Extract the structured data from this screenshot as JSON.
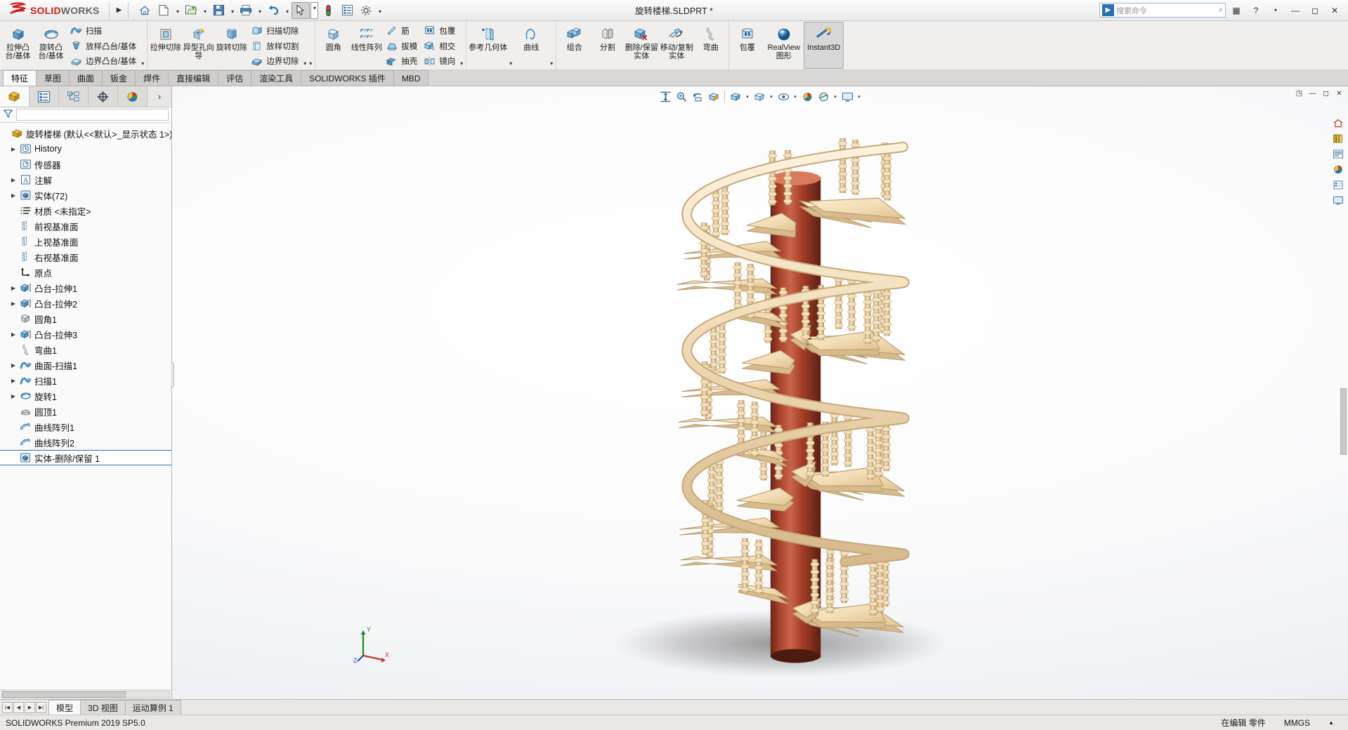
{
  "app": {
    "brand_ds": "2S",
    "brand_bold": "SOLID",
    "brand_light": "WORKS",
    "document_title": "旋转楼梯.SLDPRT *",
    "status_left": "SOLIDWORKS Premium 2019 SP5.0",
    "status_editing": "在编辑 零件",
    "status_units": "MMGS",
    "status_caret": "▲"
  },
  "titlebar": {
    "expand_icon": "▶",
    "buttons": [
      {
        "name": "home-icon",
        "glyph": "home",
        "caret": false,
        "selected": false
      },
      {
        "name": "new-document-icon",
        "glyph": "newdoc",
        "caret": true,
        "selected": false
      },
      {
        "name": "open-document-icon",
        "glyph": "open",
        "caret": true,
        "selected": false
      },
      {
        "name": "save-icon",
        "glyph": "save",
        "caret": true,
        "selected": false
      },
      {
        "name": "print-icon",
        "glyph": "print",
        "caret": true,
        "selected": false
      },
      {
        "name": "undo-icon",
        "glyph": "undo",
        "caret": true,
        "selected": false
      },
      {
        "name": "select-cursor-icon",
        "glyph": "cursor",
        "caret": true,
        "selected": true
      },
      {
        "name": "rebuild-icon",
        "glyph": "traffic",
        "caret": false,
        "selected": false
      },
      {
        "name": "options-list-icon",
        "glyph": "list",
        "caret": false,
        "selected": false
      },
      {
        "name": "settings-gear-icon",
        "glyph": "gear",
        "caret": true,
        "selected": false
      }
    ],
    "search_placeholder": "搜索命令",
    "window_buttons": [
      "▦",
      "?",
      "▾",
      "—",
      "◻",
      "✕"
    ]
  },
  "ribbon": {
    "groups": [
      {
        "name": "features-boss",
        "big": [
          {
            "label": "拉伸凸台/基体",
            "icon": "extrude-boss",
            "caret": false
          },
          {
            "label": "旋转凸台/基体",
            "icon": "revolve-boss",
            "caret": false
          }
        ],
        "small": [
          {
            "label": "扫描",
            "icon": "sweep"
          },
          {
            "label": "放样凸台/基体",
            "icon": "loft"
          },
          {
            "label": "边界凸台/基体",
            "icon": "boundary"
          }
        ],
        "small_caret": true
      },
      {
        "name": "features-cut",
        "big": [
          {
            "label": "拉伸切除",
            "icon": "extrude-cut",
            "caret": false
          },
          {
            "label": "异型孔向导",
            "icon": "hole-wizard",
            "caret": false
          },
          {
            "label": "旋转切除",
            "icon": "revolve-cut",
            "caret": false
          }
        ],
        "small": [
          {
            "label": "扫描切除",
            "icon": "sweep-cut"
          },
          {
            "label": "放样切割",
            "icon": "loft-cut"
          },
          {
            "label": "边界切除",
            "icon": "boundary-cut"
          }
        ],
        "small_caret": true
      },
      {
        "name": "features-modify",
        "big": [
          {
            "label": "圆角",
            "icon": "fillet",
            "caret": false
          },
          {
            "label": "线性阵列",
            "icon": "linear-pattern",
            "caret": false
          }
        ],
        "small": [
          {
            "label": "筋",
            "icon": "rib"
          },
          {
            "label": "拔模",
            "icon": "draft"
          },
          {
            "label": "抽壳",
            "icon": "shell"
          }
        ],
        "small2": [
          {
            "label": "包覆",
            "icon": "wrap"
          },
          {
            "label": "相交",
            "icon": "intersect"
          },
          {
            "label": "镜向",
            "icon": "mirror"
          }
        ]
      },
      {
        "name": "reference-geometry",
        "big": [
          {
            "label": "参考几何体",
            "icon": "reference-plane",
            "caret": true
          },
          {
            "label": "曲线",
            "icon": "curve",
            "caret": true
          }
        ],
        "small": []
      },
      {
        "name": "bodies",
        "big": [
          {
            "label": "组合",
            "icon": "combine",
            "caret": false
          },
          {
            "label": "分割",
            "icon": "split",
            "caret": false
          },
          {
            "label": "删除/保留实体",
            "icon": "delete-keep-body",
            "caret": false
          },
          {
            "label": "移动/复制实体",
            "icon": "move-copy-body",
            "caret": false
          },
          {
            "label": "弯曲",
            "icon": "flex",
            "caret": false
          }
        ],
        "small": []
      },
      {
        "name": "display",
        "big": [
          {
            "label": "包覆",
            "icon": "wrap2",
            "caret": false
          },
          {
            "label": "RealView 图形",
            "icon": "realview",
            "caret": false
          },
          {
            "label": "Instant3D",
            "icon": "instant3d",
            "caret": false,
            "active": true
          }
        ],
        "small": []
      }
    ]
  },
  "tabs": {
    "items": [
      {
        "label": "特征",
        "active": true
      },
      {
        "label": "草图",
        "active": false
      },
      {
        "label": "曲面",
        "active": false
      },
      {
        "label": "钣金",
        "active": false
      },
      {
        "label": "焊件",
        "active": false
      },
      {
        "label": "直接编辑",
        "active": false
      },
      {
        "label": "评估",
        "active": false
      },
      {
        "label": "渲染工具",
        "active": false
      },
      {
        "label": "SOLIDWORKS 插件",
        "active": false
      },
      {
        "label": "MBD",
        "active": false
      }
    ]
  },
  "tree_panel": {
    "tabs": [
      {
        "name": "feature-manager-tab",
        "icon": "feature-tree",
        "active": true
      },
      {
        "name": "property-manager-tab",
        "icon": "property-list",
        "active": false
      },
      {
        "name": "configuration-manager-tab",
        "icon": "configuration",
        "active": false
      },
      {
        "name": "dimxpert-manager-tab",
        "icon": "dimxpert",
        "active": false
      },
      {
        "name": "display-manager-tab",
        "icon": "appearance-sphere",
        "active": false
      }
    ],
    "more_icon": "›",
    "filter_placeholder": "",
    "root": {
      "label": "旋转楼梯  (默认<<默认>_显示状态 1>)",
      "icon": "part-root"
    },
    "items": [
      {
        "label": "History",
        "icon": "history",
        "expand": true,
        "indent": 1
      },
      {
        "label": "传感器",
        "icon": "sensor",
        "expand": false,
        "indent": 1
      },
      {
        "label": "注解",
        "icon": "annotations",
        "expand": true,
        "indent": 1
      },
      {
        "label": "实体(72)",
        "icon": "solid-bodies",
        "expand": true,
        "indent": 1
      },
      {
        "label": "材质 <未指定>",
        "icon": "material",
        "expand": false,
        "indent": 1
      },
      {
        "label": "前视基准面",
        "icon": "plane",
        "expand": false,
        "indent": 1
      },
      {
        "label": "上视基准面",
        "icon": "plane",
        "expand": false,
        "indent": 1
      },
      {
        "label": "右视基准面",
        "icon": "plane",
        "expand": false,
        "indent": 1
      },
      {
        "label": "原点",
        "icon": "origin",
        "expand": false,
        "indent": 1
      },
      {
        "label": "凸台-拉伸1",
        "icon": "extrude-feature",
        "expand": true,
        "indent": 1
      },
      {
        "label": "凸台-拉伸2",
        "icon": "extrude-feature",
        "expand": true,
        "indent": 1
      },
      {
        "label": "圆角1",
        "icon": "fillet-feature",
        "expand": false,
        "indent": 1
      },
      {
        "label": "凸台-拉伸3",
        "icon": "extrude-feature",
        "expand": true,
        "indent": 1
      },
      {
        "label": "弯曲1",
        "icon": "flex-feature",
        "expand": false,
        "indent": 1
      },
      {
        "label": "曲面-扫描1",
        "icon": "sweep-feature",
        "expand": true,
        "indent": 1
      },
      {
        "label": "扫描1",
        "icon": "sweep-feature",
        "expand": true,
        "indent": 1
      },
      {
        "label": "旋转1",
        "icon": "revolve-feature",
        "expand": true,
        "indent": 1
      },
      {
        "label": "圆顶1",
        "icon": "dome-feature",
        "expand": false,
        "indent": 1
      },
      {
        "label": "曲线阵列1",
        "icon": "curve-pattern",
        "expand": false,
        "indent": 1
      },
      {
        "label": "曲线阵列2",
        "icon": "curve-pattern",
        "expand": false,
        "indent": 1
      },
      {
        "label": "实体-删除/保留 1",
        "icon": "delete-body-feature",
        "expand": false,
        "indent": 1,
        "selected": true
      }
    ]
  },
  "viewport": {
    "toolbar": [
      {
        "name": "zoom-to-fit-icon",
        "glyph": "fit",
        "caret": false
      },
      {
        "name": "zoom-to-area-icon",
        "glyph": "zoomarea",
        "caret": false
      },
      {
        "name": "previous-view-icon",
        "glyph": "prevview",
        "caret": false
      },
      {
        "name": "section-view-icon",
        "glyph": "section",
        "caret": false
      },
      {
        "name": "sep",
        "glyph": "sep",
        "caret": false
      },
      {
        "name": "view-orientation-icon",
        "glyph": "orient",
        "caret": false
      },
      {
        "name": "display-style-icon",
        "glyph": "style",
        "caret": true
      },
      {
        "name": "hide-show-items-icon",
        "glyph": "eye",
        "caret": true
      },
      {
        "name": "edit-appearance-icon",
        "glyph": "appearance",
        "caret": false
      },
      {
        "name": "apply-scene-icon",
        "glyph": "scene",
        "caret": true
      },
      {
        "name": "view-settings-icon",
        "glyph": "viewsettings",
        "caret": true
      }
    ],
    "window_buttons": [
      "◳",
      "—",
      "◻",
      "✕"
    ],
    "right_toolbar": [
      {
        "name": "view-home-icon",
        "glyph": "vhome"
      },
      {
        "name": "appearances-icon",
        "glyph": "vappear"
      },
      {
        "name": "scenes-icon",
        "glyph": "vscene"
      },
      {
        "name": "decals-icon",
        "glyph": "vdecal"
      },
      {
        "name": "lights-cameras-icon",
        "glyph": "vlight"
      },
      {
        "name": "custom-view-icon",
        "glyph": "vcustom"
      }
    ],
    "triad_labels": {
      "x": "X",
      "y": "Y",
      "z": "Z"
    },
    "model_name": "spiral-staircase-3d-model"
  },
  "bottom": {
    "nav_buttons": [
      "|◀",
      "◀",
      "▶",
      "▶|"
    ],
    "tabs": [
      {
        "label": "模型",
        "active": true
      },
      {
        "label": "3D 视图",
        "active": false
      },
      {
        "label": "运动算例 1",
        "active": false
      }
    ]
  }
}
